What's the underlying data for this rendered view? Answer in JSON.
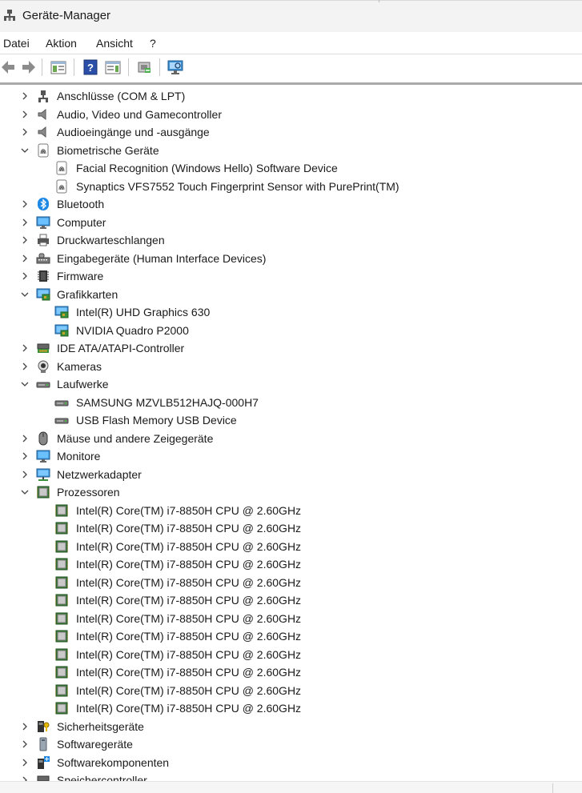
{
  "window": {
    "title": "Geräte-Manager"
  },
  "menu": [
    "Datei",
    "Aktion",
    "Ansicht",
    "?"
  ],
  "toolbar": [
    "back-icon",
    "forward-icon",
    "properties-view-icon",
    "help-icon",
    "details-pane-icon",
    "update-driver-icon",
    "scan-hardware-icon"
  ],
  "tree": [
    {
      "label": "Anschlüsse (COM & LPT)",
      "icon": "port-icon",
      "level": 0,
      "state": "collapsed"
    },
    {
      "label": "Audio, Video und Gamecontroller",
      "icon": "speaker-icon",
      "level": 0,
      "state": "collapsed"
    },
    {
      "label": "Audioeingänge und -ausgänge",
      "icon": "speaker-icon",
      "level": 0,
      "state": "collapsed"
    },
    {
      "label": "Biometrische Geräte",
      "icon": "fingerprint-icon",
      "level": 0,
      "state": "expanded"
    },
    {
      "label": "Facial Recognition (Windows Hello) Software Device",
      "icon": "fingerprint-icon",
      "level": 1
    },
    {
      "label": "Synaptics VFS7552 Touch Fingerprint Sensor with PurePrint(TM)",
      "icon": "fingerprint-icon",
      "level": 1
    },
    {
      "label": "Bluetooth",
      "icon": "bluetooth-icon",
      "level": 0,
      "state": "collapsed"
    },
    {
      "label": "Computer",
      "icon": "monitor-icon",
      "level": 0,
      "state": "collapsed"
    },
    {
      "label": "Druckwarteschlangen",
      "icon": "printer-icon",
      "level": 0,
      "state": "collapsed"
    },
    {
      "label": "Eingabegeräte (Human Interface Devices)",
      "icon": "hid-icon",
      "level": 0,
      "state": "collapsed"
    },
    {
      "label": "Firmware",
      "icon": "firmware-icon",
      "level": 0,
      "state": "collapsed"
    },
    {
      "label": "Grafikkarten",
      "icon": "display-adapter-icon",
      "level": 0,
      "state": "expanded"
    },
    {
      "label": "Intel(R) UHD Graphics 630",
      "icon": "display-adapter-icon",
      "level": 1
    },
    {
      "label": "NVIDIA Quadro P2000",
      "icon": "display-adapter-icon",
      "level": 1
    },
    {
      "label": "IDE ATA/ATAPI-Controller",
      "icon": "ide-controller-icon",
      "level": 0,
      "state": "collapsed"
    },
    {
      "label": "Kameras",
      "icon": "camera-icon",
      "level": 0,
      "state": "collapsed"
    },
    {
      "label": "Laufwerke",
      "icon": "drive-icon",
      "level": 0,
      "state": "expanded"
    },
    {
      "label": "SAMSUNG MZVLB512HAJQ-000H7",
      "icon": "drive-icon",
      "level": 1
    },
    {
      "label": "USB Flash Memory USB Device",
      "icon": "drive-icon",
      "level": 1
    },
    {
      "label": "Mäuse und andere Zeigegeräte",
      "icon": "mouse-icon",
      "level": 0,
      "state": "collapsed"
    },
    {
      "label": "Monitore",
      "icon": "monitor-icon",
      "level": 0,
      "state": "collapsed"
    },
    {
      "label": "Netzwerkadapter",
      "icon": "network-icon",
      "level": 0,
      "state": "collapsed"
    },
    {
      "label": "Prozessoren",
      "icon": "cpu-icon",
      "level": 0,
      "state": "expanded"
    },
    {
      "label": "Intel(R) Core(TM) i7-8850H CPU @ 2.60GHz",
      "icon": "cpu-icon",
      "level": 1
    },
    {
      "label": "Intel(R) Core(TM) i7-8850H CPU @ 2.60GHz",
      "icon": "cpu-icon",
      "level": 1
    },
    {
      "label": "Intel(R) Core(TM) i7-8850H CPU @ 2.60GHz",
      "icon": "cpu-icon",
      "level": 1
    },
    {
      "label": "Intel(R) Core(TM) i7-8850H CPU @ 2.60GHz",
      "icon": "cpu-icon",
      "level": 1
    },
    {
      "label": "Intel(R) Core(TM) i7-8850H CPU @ 2.60GHz",
      "icon": "cpu-icon",
      "level": 1
    },
    {
      "label": "Intel(R) Core(TM) i7-8850H CPU @ 2.60GHz",
      "icon": "cpu-icon",
      "level": 1
    },
    {
      "label": "Intel(R) Core(TM) i7-8850H CPU @ 2.60GHz",
      "icon": "cpu-icon",
      "level": 1
    },
    {
      "label": "Intel(R) Core(TM) i7-8850H CPU @ 2.60GHz",
      "icon": "cpu-icon",
      "level": 1
    },
    {
      "label": "Intel(R) Core(TM) i7-8850H CPU @ 2.60GHz",
      "icon": "cpu-icon",
      "level": 1
    },
    {
      "label": "Intel(R) Core(TM) i7-8850H CPU @ 2.60GHz",
      "icon": "cpu-icon",
      "level": 1
    },
    {
      "label": "Intel(R) Core(TM) i7-8850H CPU @ 2.60GHz",
      "icon": "cpu-icon",
      "level": 1
    },
    {
      "label": "Intel(R) Core(TM) i7-8850H CPU @ 2.60GHz",
      "icon": "cpu-icon",
      "level": 1
    },
    {
      "label": "Sicherheitsgeräte",
      "icon": "security-device-icon",
      "level": 0,
      "state": "collapsed"
    },
    {
      "label": "Softwaregeräte",
      "icon": "software-device-icon",
      "level": 0,
      "state": "collapsed"
    },
    {
      "label": "Softwarekomponenten",
      "icon": "software-component-icon",
      "level": 0,
      "state": "collapsed"
    },
    {
      "label": "Speichercontroller",
      "icon": "storage-controller-icon",
      "level": 0,
      "state": "collapsed"
    }
  ]
}
